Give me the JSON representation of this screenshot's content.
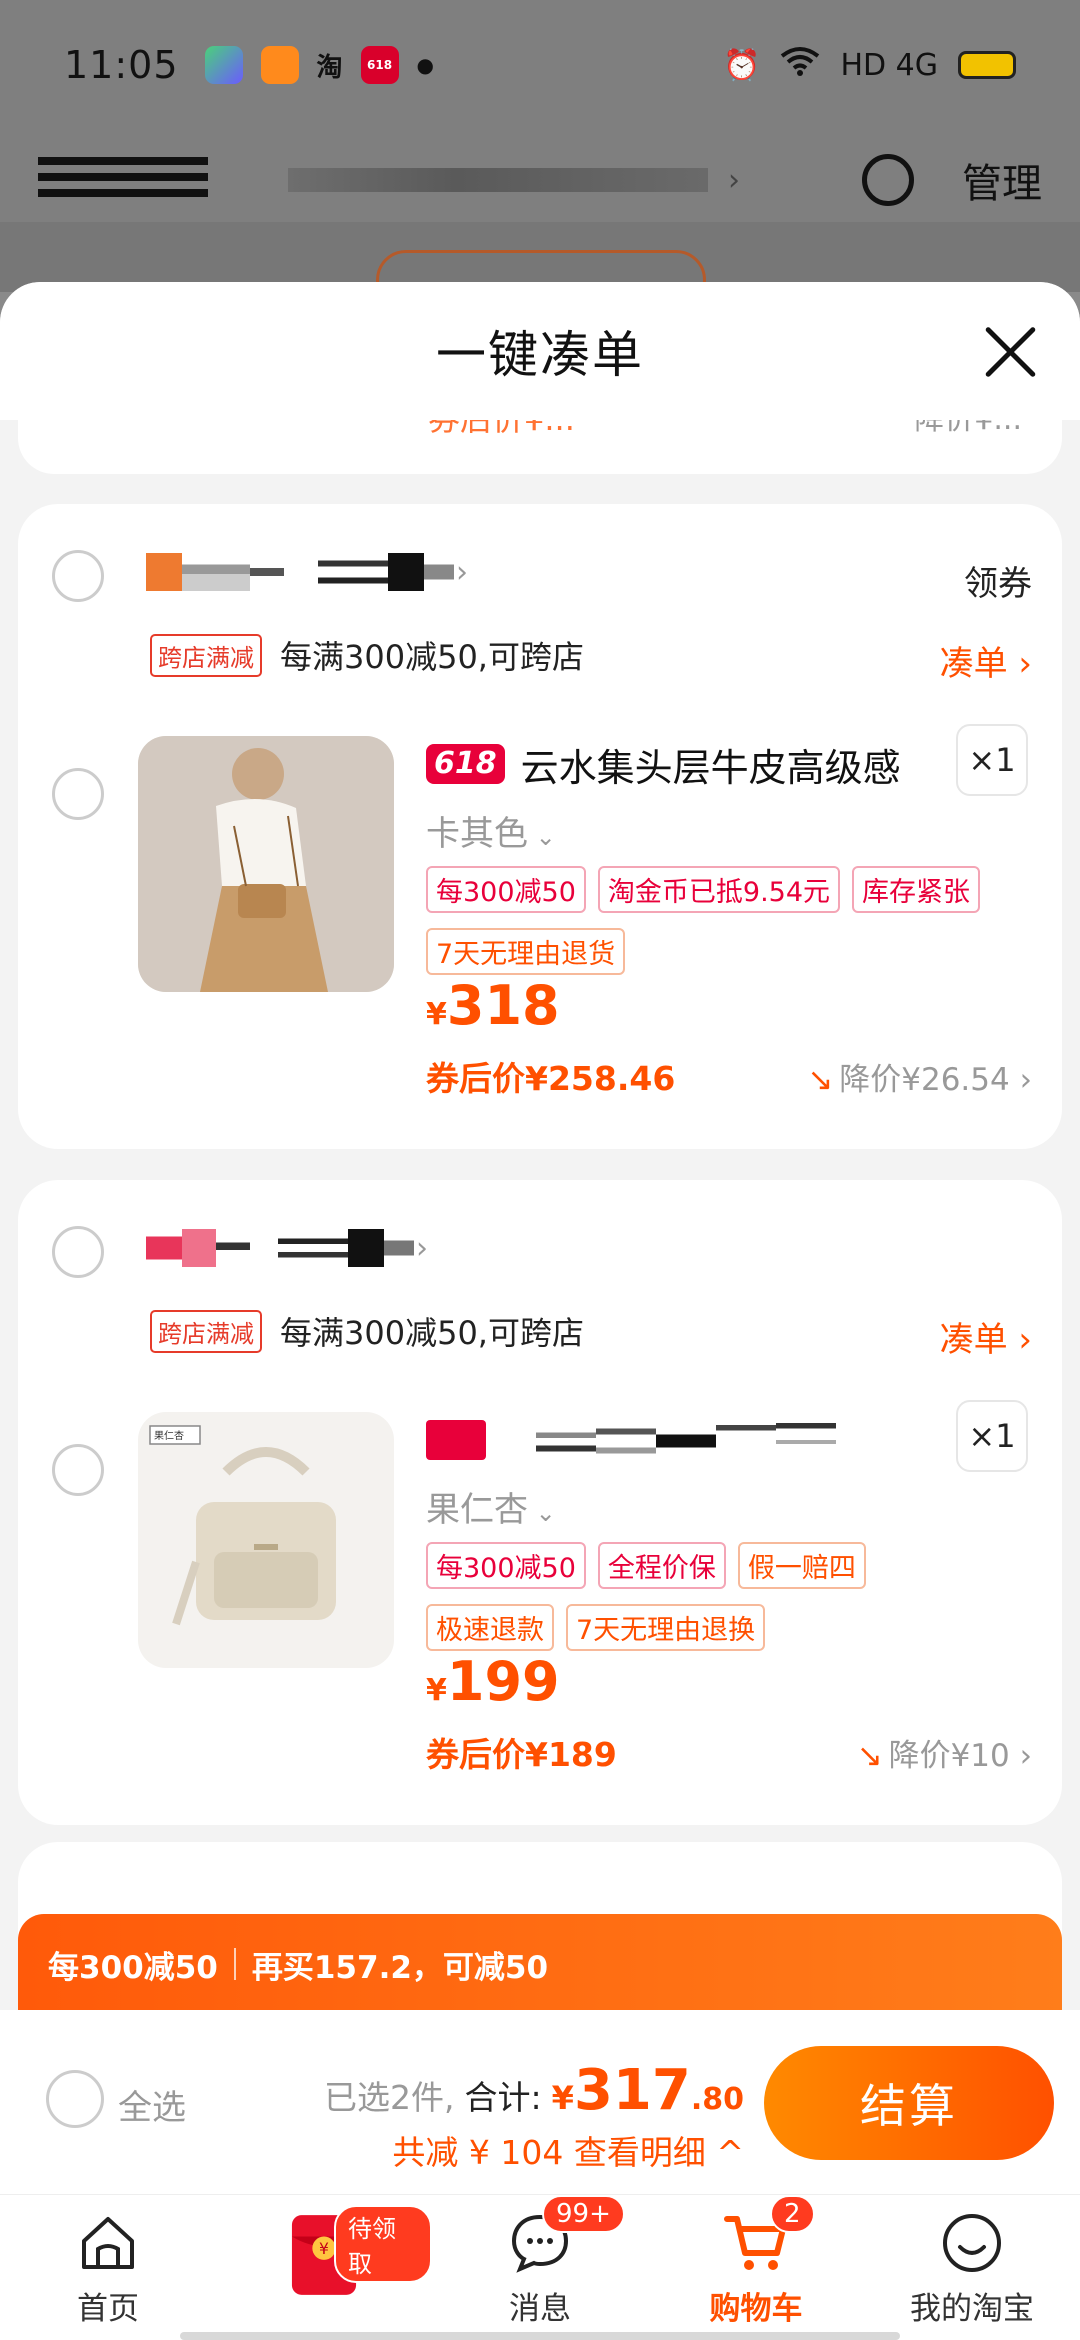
{
  "status_bar": {
    "time": "11:05",
    "apps": [
      "iQIYI",
      "tmall",
      "淘",
      "618"
    ],
    "network": "HD 4G"
  },
  "background": {
    "manage_label": "管理"
  },
  "sheet": {
    "title": "一键凑单",
    "peek_price": "券后价¥...",
    "peek_drop": "降价¥..."
  },
  "shops": [
    {
      "coupon_label": "领券",
      "promo_tag": "跨店满减",
      "promo_text": "每满300减50,可跨店",
      "coudan_label": "凑单 ›",
      "product": {
        "badge": "618",
        "title": "云水集头层牛皮高级感",
        "qty": "×1",
        "sku": "卡其色",
        "tags_row1": [
          "每300减50",
          "淘金币已抵9.54元",
          "库存紧张"
        ],
        "tags_row2": [
          "7天无理由退货"
        ],
        "currency": "¥",
        "price": "318",
        "after_price": "券后价¥258.46",
        "drop": "降价¥26.54 ›"
      }
    },
    {
      "coupon_label": "",
      "promo_tag": "跨店满减",
      "promo_text": "每满300减50,可跨店",
      "coudan_label": "凑单 ›",
      "product": {
        "image_label": "果仁杏",
        "qty": "×1",
        "sku": "果仁杏",
        "tags_row1": [
          "每300减50",
          "全程价保",
          "假一赔四"
        ],
        "tags_row2": [
          "极速退款",
          "7天无理由退换"
        ],
        "currency": "¥",
        "price": "199",
        "after_price": "券后价¥189",
        "drop": "降价¥10 ›"
      }
    }
  ],
  "promo_banner": {
    "left": "每300减50",
    "right": "再买157.2，可减50"
  },
  "checkout": {
    "select_all": "全选",
    "selected": "已选2件,",
    "total_label": "合计:",
    "currency": "¥",
    "total_int": "317",
    "total_dec": ".80",
    "savings": "共减 ¥ 104  查看明细 ^",
    "button": "结算"
  },
  "tabbar": [
    {
      "label": "首页",
      "icon": "home-icon"
    },
    {
      "label": "",
      "icon": "red-packet-icon",
      "badge": "待领取"
    },
    {
      "label": "消息",
      "icon": "message-icon",
      "badge": "99+"
    },
    {
      "label": "购物车",
      "icon": "cart-icon",
      "badge": "2",
      "active": true
    },
    {
      "label": "我的淘宝",
      "icon": "profile-icon"
    }
  ],
  "colors": {
    "accent": "#ff5000",
    "brand_red": "#e8003a",
    "gray_text": "#999999"
  }
}
